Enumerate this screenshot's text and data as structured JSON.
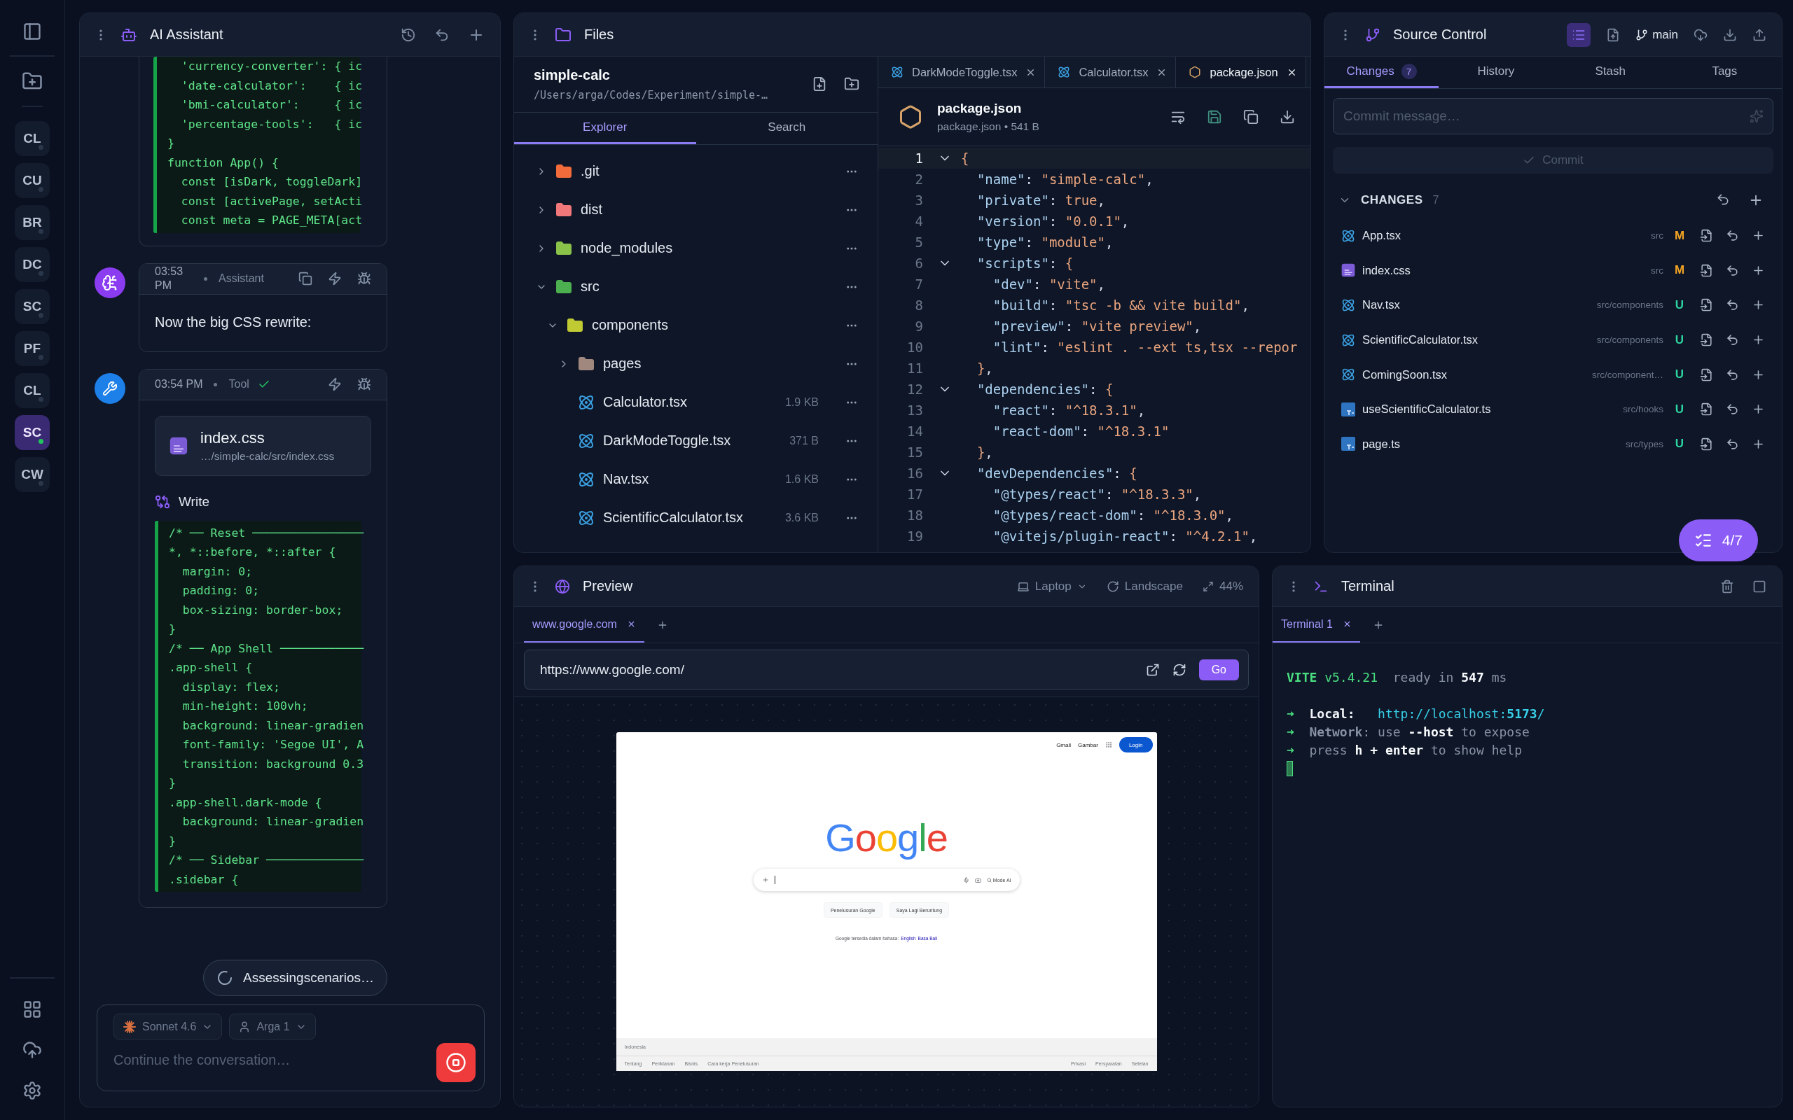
{
  "rail": {
    "projects": [
      {
        "label": "CL",
        "selected": false
      },
      {
        "label": "CU",
        "selected": false
      },
      {
        "label": "BR",
        "selected": false
      },
      {
        "label": "DC",
        "selected": false
      },
      {
        "label": "SC",
        "selected": false
      },
      {
        "label": "PF",
        "selected": false
      },
      {
        "label": "CL",
        "selected": false
      },
      {
        "label": "SC",
        "selected": true
      },
      {
        "label": "CW",
        "selected": false
      }
    ]
  },
  "assistant": {
    "title": "AI Assistant",
    "messages": [
      {
        "kind": "code",
        "lines": [
          "  'currency-converter': { ic",
          "  'date-calculator':    { ic",
          "  'bmi-calculator':     { ic",
          "  'percentage-tools':   { ic",
          "}",
          "function App() {",
          "  const [isDark, toggleDark]",
          "  const [activePage, setActi",
          "  const meta = PAGE_META[act"
        ]
      },
      {
        "kind": "text",
        "time": "03:53 PM",
        "author": "Assistant",
        "text": "Now the big CSS rewrite:"
      },
      {
        "kind": "tool",
        "time": "03:54 PM",
        "author": "Tool",
        "done": true,
        "file": {
          "name": "index.css",
          "path": "…/simple-calc/src/index.css"
        },
        "action": "Write",
        "lines": [
          "/* ── Reset ────────────────",
          "*, *::before, *::after {",
          "  margin: 0;",
          "  padding: 0;",
          "  box-sizing: border-box;",
          "}",
          "/* ── App Shell ────────────",
          ".app-shell {",
          "  display: flex;",
          "  min-height: 100vh;",
          "  background: linear-gradien",
          "  font-family: 'Segoe UI', A",
          "  transition: background 0.3",
          "}",
          ".app-shell.dark-mode {",
          "  background: linear-gradien",
          "}",
          "/* ── Sidebar ──────────────",
          ".sidebar {"
        ]
      }
    ],
    "status": "Assessingscenarios…",
    "composer": {
      "model": "Sonnet 4.6",
      "user": "Arga 1",
      "placeholder": "Continue the conversation…"
    }
  },
  "files": {
    "title": "Files",
    "project": "simple-calc",
    "path": "/Users/arga/Codes/Experiment/simple-…",
    "tabs": [
      {
        "label": "Explorer",
        "selected": true
      },
      {
        "label": "Search",
        "selected": false
      }
    ],
    "tree": [
      {
        "name": ".git",
        "kind": "folder",
        "color": "#f26b3a",
        "expanded": false
      },
      {
        "name": "dist",
        "kind": "folder",
        "color": "#f0787a",
        "expanded": false
      },
      {
        "name": "node_modules",
        "kind": "folder",
        "color": "#8bc34a",
        "expanded": false
      },
      {
        "name": "src",
        "kind": "folder",
        "color": "#4caf50",
        "expanded": true,
        "children": [
          {
            "name": "components",
            "kind": "folder",
            "color": "#c0ca33",
            "expanded": true,
            "children": [
              {
                "name": "pages",
                "kind": "folder",
                "color": "#a1887f",
                "expanded": false
              },
              {
                "name": "Calculator.tsx",
                "kind": "react",
                "size": "1.9 KB"
              },
              {
                "name": "DarkModeToggle.tsx",
                "kind": "react",
                "size": "371 B"
              },
              {
                "name": "Nav.tsx",
                "kind": "react",
                "size": "1.6 KB"
              },
              {
                "name": "ScientificCalculator.tsx",
                "kind": "react",
                "size": "3.6 KB"
              }
            ]
          }
        ]
      }
    ]
  },
  "editor": {
    "tabs": [
      {
        "label": "DarkModeToggle.tsx",
        "kind": "react",
        "selected": false
      },
      {
        "label": "Calculator.tsx",
        "kind": "react",
        "selected": false
      },
      {
        "label": "package.json",
        "kind": "js",
        "selected": true
      }
    ],
    "file": {
      "name": "package.json",
      "meta": "package.json • 541 B"
    },
    "lines": [
      {
        "n": "1",
        "fold": true,
        "active": true,
        "text": "{"
      },
      {
        "n": "2",
        "fold": false,
        "active": false,
        "text": "  \"name\": \"simple-calc\","
      },
      {
        "n": "3",
        "fold": false,
        "active": false,
        "text": "  \"private\": true,"
      },
      {
        "n": "4",
        "fold": false,
        "active": false,
        "text": "  \"version\": \"0.0.1\","
      },
      {
        "n": "5",
        "fold": false,
        "active": false,
        "text": "  \"type\": \"module\","
      },
      {
        "n": "6",
        "fold": true,
        "active": false,
        "text": "  \"scripts\": {"
      },
      {
        "n": "7",
        "fold": false,
        "active": false,
        "text": "    \"dev\": \"vite\","
      },
      {
        "n": "8",
        "fold": false,
        "active": false,
        "text": "    \"build\": \"tsc -b && vite build\","
      },
      {
        "n": "9",
        "fold": false,
        "active": false,
        "text": "    \"preview\": \"vite preview\","
      },
      {
        "n": "10",
        "fold": false,
        "active": false,
        "text": "    \"lint\": \"eslint . --ext ts,tsx --repor"
      },
      {
        "n": "11",
        "fold": false,
        "active": false,
        "text": "  },"
      },
      {
        "n": "12",
        "fold": true,
        "active": false,
        "text": "  \"dependencies\": {"
      },
      {
        "n": "13",
        "fold": false,
        "active": false,
        "text": "    \"react\": \"^18.3.1\","
      },
      {
        "n": "14",
        "fold": false,
        "active": false,
        "text": "    \"react-dom\": \"^18.3.1\""
      },
      {
        "n": "15",
        "fold": false,
        "active": false,
        "text": "  },"
      },
      {
        "n": "16",
        "fold": true,
        "active": false,
        "text": "  \"devDependencies\": {"
      },
      {
        "n": "17",
        "fold": false,
        "active": false,
        "text": "    \"@types/react\": \"^18.3.3\","
      },
      {
        "n": "18",
        "fold": false,
        "active": false,
        "text": "    \"@types/react-dom\": \"^18.3.0\","
      },
      {
        "n": "19",
        "fold": false,
        "active": false,
        "text": "    \"@vitejs/plugin-react\": \"^4.2.1\","
      }
    ]
  },
  "source_control": {
    "title": "Source Control",
    "list_view": true,
    "branch": "main",
    "tabs": [
      {
        "label": "Changes",
        "count": "7",
        "selected": true
      },
      {
        "label": "History",
        "selected": false
      },
      {
        "label": "Stash",
        "selected": false
      },
      {
        "label": "Tags",
        "selected": false
      }
    ],
    "commit": {
      "placeholder": "Commit message…",
      "button": "Commit",
      "disabled": true
    },
    "changes": {
      "title": "CHANGES",
      "count": "7",
      "files": [
        {
          "name": "App.tsx",
          "kind": "react",
          "path": "src",
          "status": "M",
          "color": "#f5a524"
        },
        {
          "name": "index.css",
          "kind": "css",
          "path": "src",
          "status": "M",
          "color": "#f5a524"
        },
        {
          "name": "Nav.tsx",
          "kind": "react",
          "path": "src/components",
          "status": "U",
          "color": "#2dd4a0"
        },
        {
          "name": "ScientificCalculator.tsx",
          "kind": "react",
          "path": "src/components",
          "status": "U",
          "color": "#2dd4a0"
        },
        {
          "name": "ComingSoon.tsx",
          "kind": "react",
          "path": "src/component…",
          "status": "U",
          "color": "#2dd4a0"
        },
        {
          "name": "useScientificCalculator.ts",
          "kind": "ts",
          "path": "src/hooks",
          "status": "U",
          "color": "#2dd4a0"
        },
        {
          "name": "page.ts",
          "kind": "ts",
          "path": "src/types",
          "status": "U",
          "color": "#2dd4a0"
        }
      ]
    },
    "progress": "4/7"
  },
  "preview": {
    "title": "Preview",
    "device": "Laptop",
    "orientation": "Landscape",
    "zoom": "44%",
    "tabs": [
      {
        "label": "www.google.com",
        "selected": true
      }
    ],
    "url": "https://www.google.com/",
    "go": "Go",
    "page": {
      "top_links": [
        "Gmail",
        "Gambar"
      ],
      "login": "Login",
      "logo": "Google",
      "search_chip": "Mode AI",
      "buttons": [
        "Penelusuran Google",
        "Saya Lagi Beruntung"
      ],
      "language_note": "Google tersedia dalam bahasa:",
      "languages": [
        "English",
        "Basa Bali"
      ],
      "region": "Indonesia",
      "footer_left": [
        "Tentang",
        "Periklanan",
        "Bisnis",
        "Cara kerja Penelusuran"
      ],
      "footer_right": [
        "Privasi",
        "Persyaratan",
        "Setelan"
      ]
    }
  },
  "terminal": {
    "title": "Terminal",
    "tabs": [
      {
        "label": "Terminal 1",
        "selected": true
      }
    ],
    "lines": [
      {
        "kind": "banner",
        "segments": [
          {
            "text": "VITE ",
            "kind": "brand"
          },
          {
            "text": "v5.4.21  ",
            "kind": "accent"
          },
          {
            "text": "ready in ",
            "kind": "dim"
          },
          {
            "text": "547",
            "kind": "strong"
          },
          {
            "text": " ms",
            "kind": "dim"
          }
        ]
      },
      {
        "kind": "info",
        "segments": [
          {
            "text": "➜  ",
            "kind": "arrow"
          },
          {
            "text": "Local:   ",
            "kind": "label"
          },
          {
            "text": "http://localhost:",
            "kind": "link"
          },
          {
            "text": "5173",
            "kind": "link_strong"
          },
          {
            "text": "/",
            "kind": "link"
          }
        ]
      },
      {
        "kind": "info",
        "segments": [
          {
            "text": "➜  ",
            "kind": "arrow"
          },
          {
            "text": "Network",
            "kind": "muted_label"
          },
          {
            "text": ": use ",
            "kind": "dim"
          },
          {
            "text": "--host",
            "kind": "strong"
          },
          {
            "text": " to expose",
            "kind": "dim"
          }
        ]
      },
      {
        "kind": "info",
        "segments": [
          {
            "text": "➜  ",
            "kind": "arrow"
          },
          {
            "text": "press ",
            "kind": "dim"
          },
          {
            "text": "h + enter",
            "kind": "strong"
          },
          {
            "text": " to show help",
            "kind": "dim"
          }
        ]
      }
    ],
    "cursor": true
  }
}
